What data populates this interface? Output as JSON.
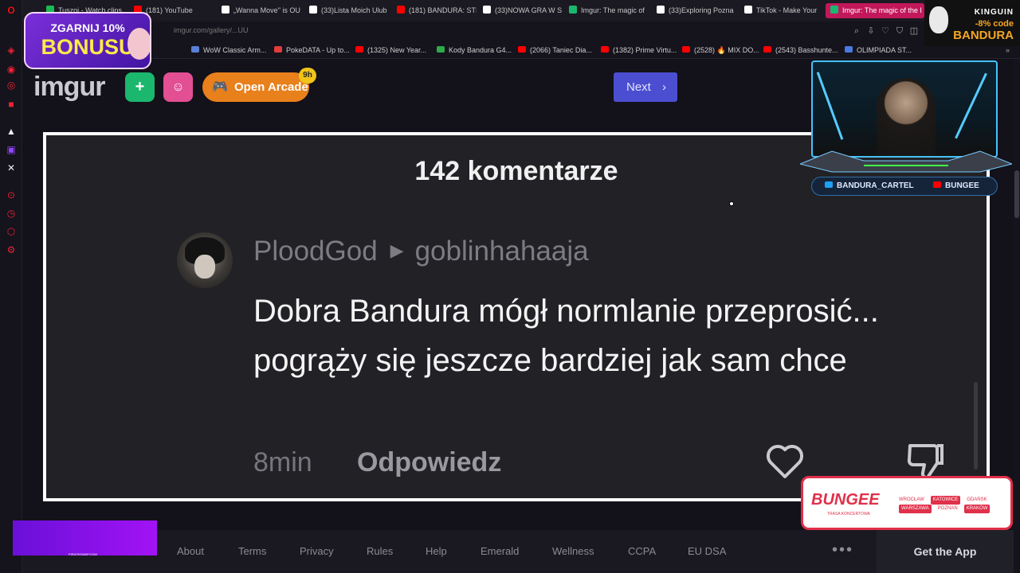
{
  "rail_icons": [
    "opera-icon",
    "ai-icon",
    "messenger-icon",
    "instagram-icon",
    "music-icon",
    "twitch-icon",
    "x-icon",
    "player-icon",
    "history-icon",
    "extensions-icon",
    "settings-icon"
  ],
  "tabs": [
    {
      "label": "Tuszoj - Watch clips",
      "color": "#1db954"
    },
    {
      "label": "(181) YouTube",
      "color": "#ff0000"
    },
    {
      "label": "„Wanna Move\" is OU",
      "color": "#ffffff"
    },
    {
      "label": "(33)Lista Moich Ulub",
      "color": "#ffffff"
    },
    {
      "label": "(181) BANDURA: STI",
      "color": "#ff0000"
    },
    {
      "label": "(33)NOWA GRA W S",
      "color": "#ffffff"
    },
    {
      "label": "Imgur: The magic of",
      "color": "#1bb76e"
    },
    {
      "label": "(33)Exploring Pozna",
      "color": "#ffffff"
    },
    {
      "label": "TikTok - Make Your",
      "color": "#ffffff"
    },
    {
      "label": "Imgur: The magic of the I",
      "color": "#1bb76e"
    }
  ],
  "address": {
    "url": "imgur.com/gallery/...UU"
  },
  "bookmarks": [
    {
      "label": "WoW Classic Arm...",
      "color": "#5b7fd6"
    },
    {
      "label": "PokeDATA - Up to...",
      "color": "#e23b3b"
    },
    {
      "label": "(1325) New Year...",
      "color": "#ff0000"
    },
    {
      "label": "Kody Bandura G4...",
      "color": "#2eaa4a"
    },
    {
      "label": "(2066) Taniec Dia...",
      "color": "#ff0000"
    },
    {
      "label": "(1382) Prime Virtu...",
      "color": "#ff0000"
    },
    {
      "label": "(2528) 🔥 MIX DO...",
      "color": "#ff0000"
    },
    {
      "label": "(2543) Basshunte...",
      "color": "#ff0000"
    },
    {
      "label": "OLIMPIADA ST...",
      "color": "#4a7ae0"
    }
  ],
  "imgur": {
    "logo": "imgur",
    "arcade_label": "Open Arcade",
    "arcade_badge": "9h",
    "next_label": "Next",
    "next_chevron": "›",
    "plus": "+",
    "accent_green": "#1bb76e",
    "accent_pink": "#e24f93",
    "accent_orange": "#e8801c",
    "accent_blue": "#4b4ed0"
  },
  "comments": {
    "count_label": "142 komentarze",
    "comment": {
      "author": "PloodGod",
      "reply_to": "goblinhahaaja",
      "text": "Dobra Bandura mógł normlanie przeprosić... pogrąży się jeszcze bardziej jak sam chce",
      "time": "8min",
      "reply_label": "Odpowiedz"
    }
  },
  "footer": {
    "links": [
      "About",
      "Terms",
      "Privacy",
      "Rules",
      "Help",
      "Emerald",
      "Wellness",
      "CCPA",
      "EU DSA"
    ],
    "more": "•••",
    "get_app": "Get the App"
  },
  "overlays": {
    "promo_line1": "ZGARNIJ 10%",
    "promo_line2": "BONUSU",
    "kinguin_brand": "KINGUIN",
    "kinguin_code": "-8% code",
    "kinguin_name": "BANDURA",
    "socials": [
      {
        "label": "BANDURA_CARTEL",
        "color": "#1da1f2"
      },
      {
        "label": "BUNGEE",
        "color": "#ff0000"
      }
    ],
    "bungee_logo": "BUNGEE",
    "bungee_sub": "TRASA KONCERTOWA",
    "bungee_cities": [
      "WROCŁAW",
      "KATOWICE",
      "GDAŃSK",
      "WARSZAWA",
      "POZNAŃ",
      "KRAKÓW"
    ],
    "purple_text": "PIRATESWAP.COM"
  }
}
